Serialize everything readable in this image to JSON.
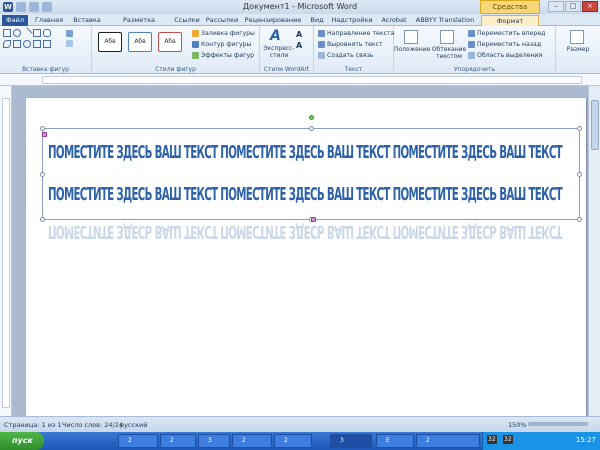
{
  "window": {
    "title": "Документ1 - Microsoft Word",
    "contextual_tab_header": "Средства рисования",
    "app_icon": "W"
  },
  "tabs": [
    "Файл",
    "Главная",
    "Вставка",
    "Разметка страницы",
    "Ссылки",
    "Рассылки",
    "Рецензирование",
    "Вид",
    "Надстройки",
    "Acrobat",
    "ABBYY Translation",
    "Формат"
  ],
  "ribbon": {
    "insert_shapes": {
      "label": "Вставка фигур"
    },
    "shape_styles": {
      "label": "Стили фигур",
      "presets": [
        "Абв",
        "Абв",
        "Абв"
      ],
      "fill": "Заливка фигуры",
      "outline": "Контур фигуры",
      "effects": "Эффекты фигур"
    },
    "wordart_styles": {
      "label": "Стили WordArt",
      "express": "Экспресс-стили",
      "text_fill_letter": "A",
      "text_outline_letter": "A"
    },
    "text": {
      "label": "Текст",
      "direction": "Направление текста",
      "align": "Выровнять текст",
      "link": "Создать связь"
    },
    "arrange": {
      "label": "Упорядочить",
      "position": "Положение",
      "wrap": "Обтекание текстом",
      "forward": "Переместить вперед",
      "backward": "Переместить назад",
      "selection_pane": "Область выделения"
    },
    "size": {
      "label": "Размер"
    }
  },
  "document": {
    "wordart_lines": [
      "ПОМЕСТИТЕ ЗДЕСЬ ВАШ ТЕКСТ ПОМЕСТИТЕ ЗДЕСЬ ВАШ ТЕКСТ ПОМЕСТИТЕ ЗДЕСЬ ВАШ ТЕКСТ",
      "ПОМЕСТИТЕ ЗДЕСЬ ВАШ ТЕКСТ ПОМЕСТИТЕ ЗДЕСЬ ВАШ ТЕКСТ ПОМЕСТИТЕ ЗДЕСЬ ВАШ ТЕКСТ"
    ],
    "text_color": "#2e62a8"
  },
  "status": {
    "page": "Страница: 1 из 1",
    "words": "Число слов: 24/24",
    "language": "русский",
    "zoom": "150%"
  },
  "taskbar": {
    "start": "пуск",
    "buttons": [
      "2",
      "2",
      "3",
      "2",
      "2",
      "3",
      "E",
      "2"
    ],
    "clock": "15:27",
    "tray_numbers": [
      "32",
      "32"
    ]
  },
  "colors": {
    "accent": "#2b579a",
    "wordart": "#2e62a8",
    "context_tab": "#f7d777"
  }
}
